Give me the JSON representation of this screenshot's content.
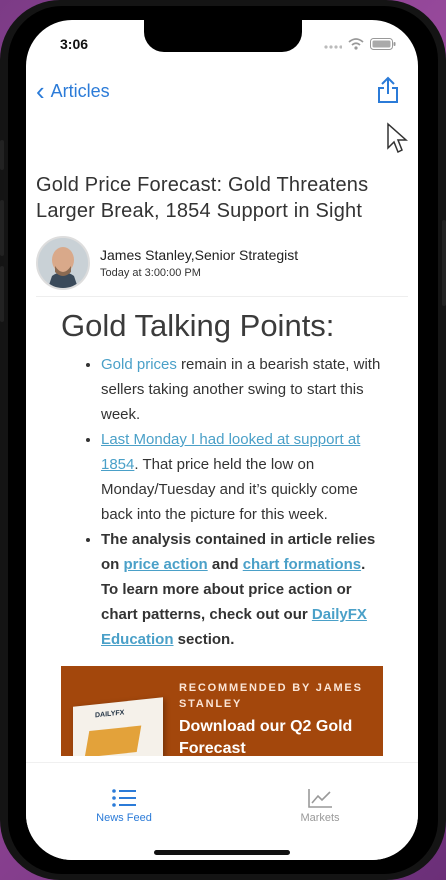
{
  "status": {
    "time": "3:06"
  },
  "nav": {
    "back_label": "Articles"
  },
  "article": {
    "headline": "Gold Price Forecast: Gold Threatens Larger Break, 1854 Support in Sight",
    "author": "James Stanley,Senior Strategist",
    "time": "Today at 3:00:00 PM",
    "talking_points_title": "Gold Talking Points:",
    "bullet1": {
      "link": "Gold prices",
      "text": " remain in a bearish state, with sellers taking another swing to start this week."
    },
    "bullet2": {
      "link": "Last Monday I had looked at support at 1854",
      "text": ". That price held the low on Monday/Tuesday and it’s quickly come back into the picture for this week."
    },
    "bullet3": {
      "text1": "The analysis contained in article relies on ",
      "link1": "price action",
      "text2": " and ",
      "link2": "chart formations",
      "text3": ". To learn more about price action or chart patterns, check out our ",
      "link3": "DailyFX Education",
      "text4": " section."
    }
  },
  "promo": {
    "recommended": "RECOMMENDED BY JAMES STANLEY",
    "title": "Download our Q2 Gold Forecast",
    "book_logo": "DAILYFX"
  },
  "tabs": {
    "news_feed": "News Feed",
    "markets": "Markets"
  },
  "colors": {
    "accent": "#2b7bd8",
    "link": "#4aa0c8",
    "promo_bg": "#a3470c"
  }
}
